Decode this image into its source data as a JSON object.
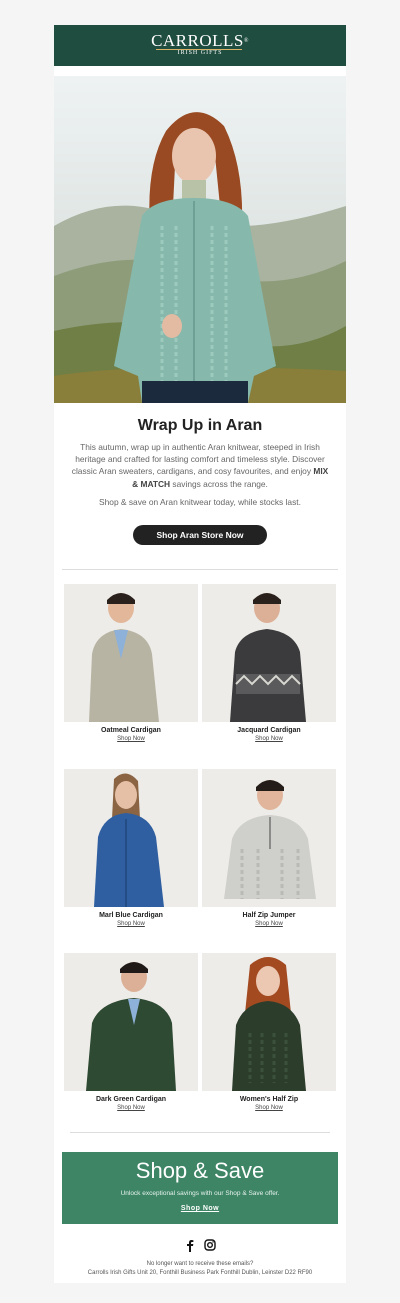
{
  "header": {
    "logo_text": "CARROLLS",
    "logo_reg": "®",
    "logo_sub": "IRISH GIFTS"
  },
  "hero": {
    "headline": "Wrap Up in Aran",
    "body_before": "This autumn, wrap up in authentic Aran knitwear, steeped in Irish heritage and crafted for lasting comfort and timeless style. Discover classic Aran sweaters, cardigans, and cosy favourites, and enjoy ",
    "body_bold": "MIX & MATCH",
    "body_after": " savings across the range.",
    "subtext": "Shop & save on Aran knitwear today, while stocks last.",
    "cta_label": "Shop Aran Store Now"
  },
  "products": [
    {
      "name": "Oatmeal Cardigan",
      "link": "Shop Now",
      "color": "#b7b4a3"
    },
    {
      "name": "Jacquard Cardigan",
      "link": "Shop Now",
      "color": "#3b3b3d"
    },
    {
      "name": "Marl Blue Cardigan",
      "link": "Shop Now",
      "color": "#2f5fa0"
    },
    {
      "name": "Half Zip Jumper",
      "link": "Shop Now",
      "color": "#cfcfcc"
    },
    {
      "name": "Dark Green Cardigan",
      "link": "Shop Now",
      "color": "#2f4a33"
    },
    {
      "name": "Women's Half Zip",
      "link": "Shop Now",
      "color": "#2c3d2c"
    }
  ],
  "banner": {
    "title": "Shop & Save",
    "text": "Unlock exceptional savings with our Shop & Save offer.",
    "link": "Shop Now"
  },
  "social": [
    "facebook-icon",
    "instagram-icon"
  ],
  "footer": {
    "unsubscribe": "No longer want to receive these emails?",
    "address": "Carrolls Irish Gifts Unit 20, Fonthill Business Park Fonthill Dublin, Leinster D22 RF90"
  },
  "colors": {
    "brand_green": "#1f4d3f",
    "banner_green": "#3e8566",
    "cta_dark": "#222222"
  }
}
